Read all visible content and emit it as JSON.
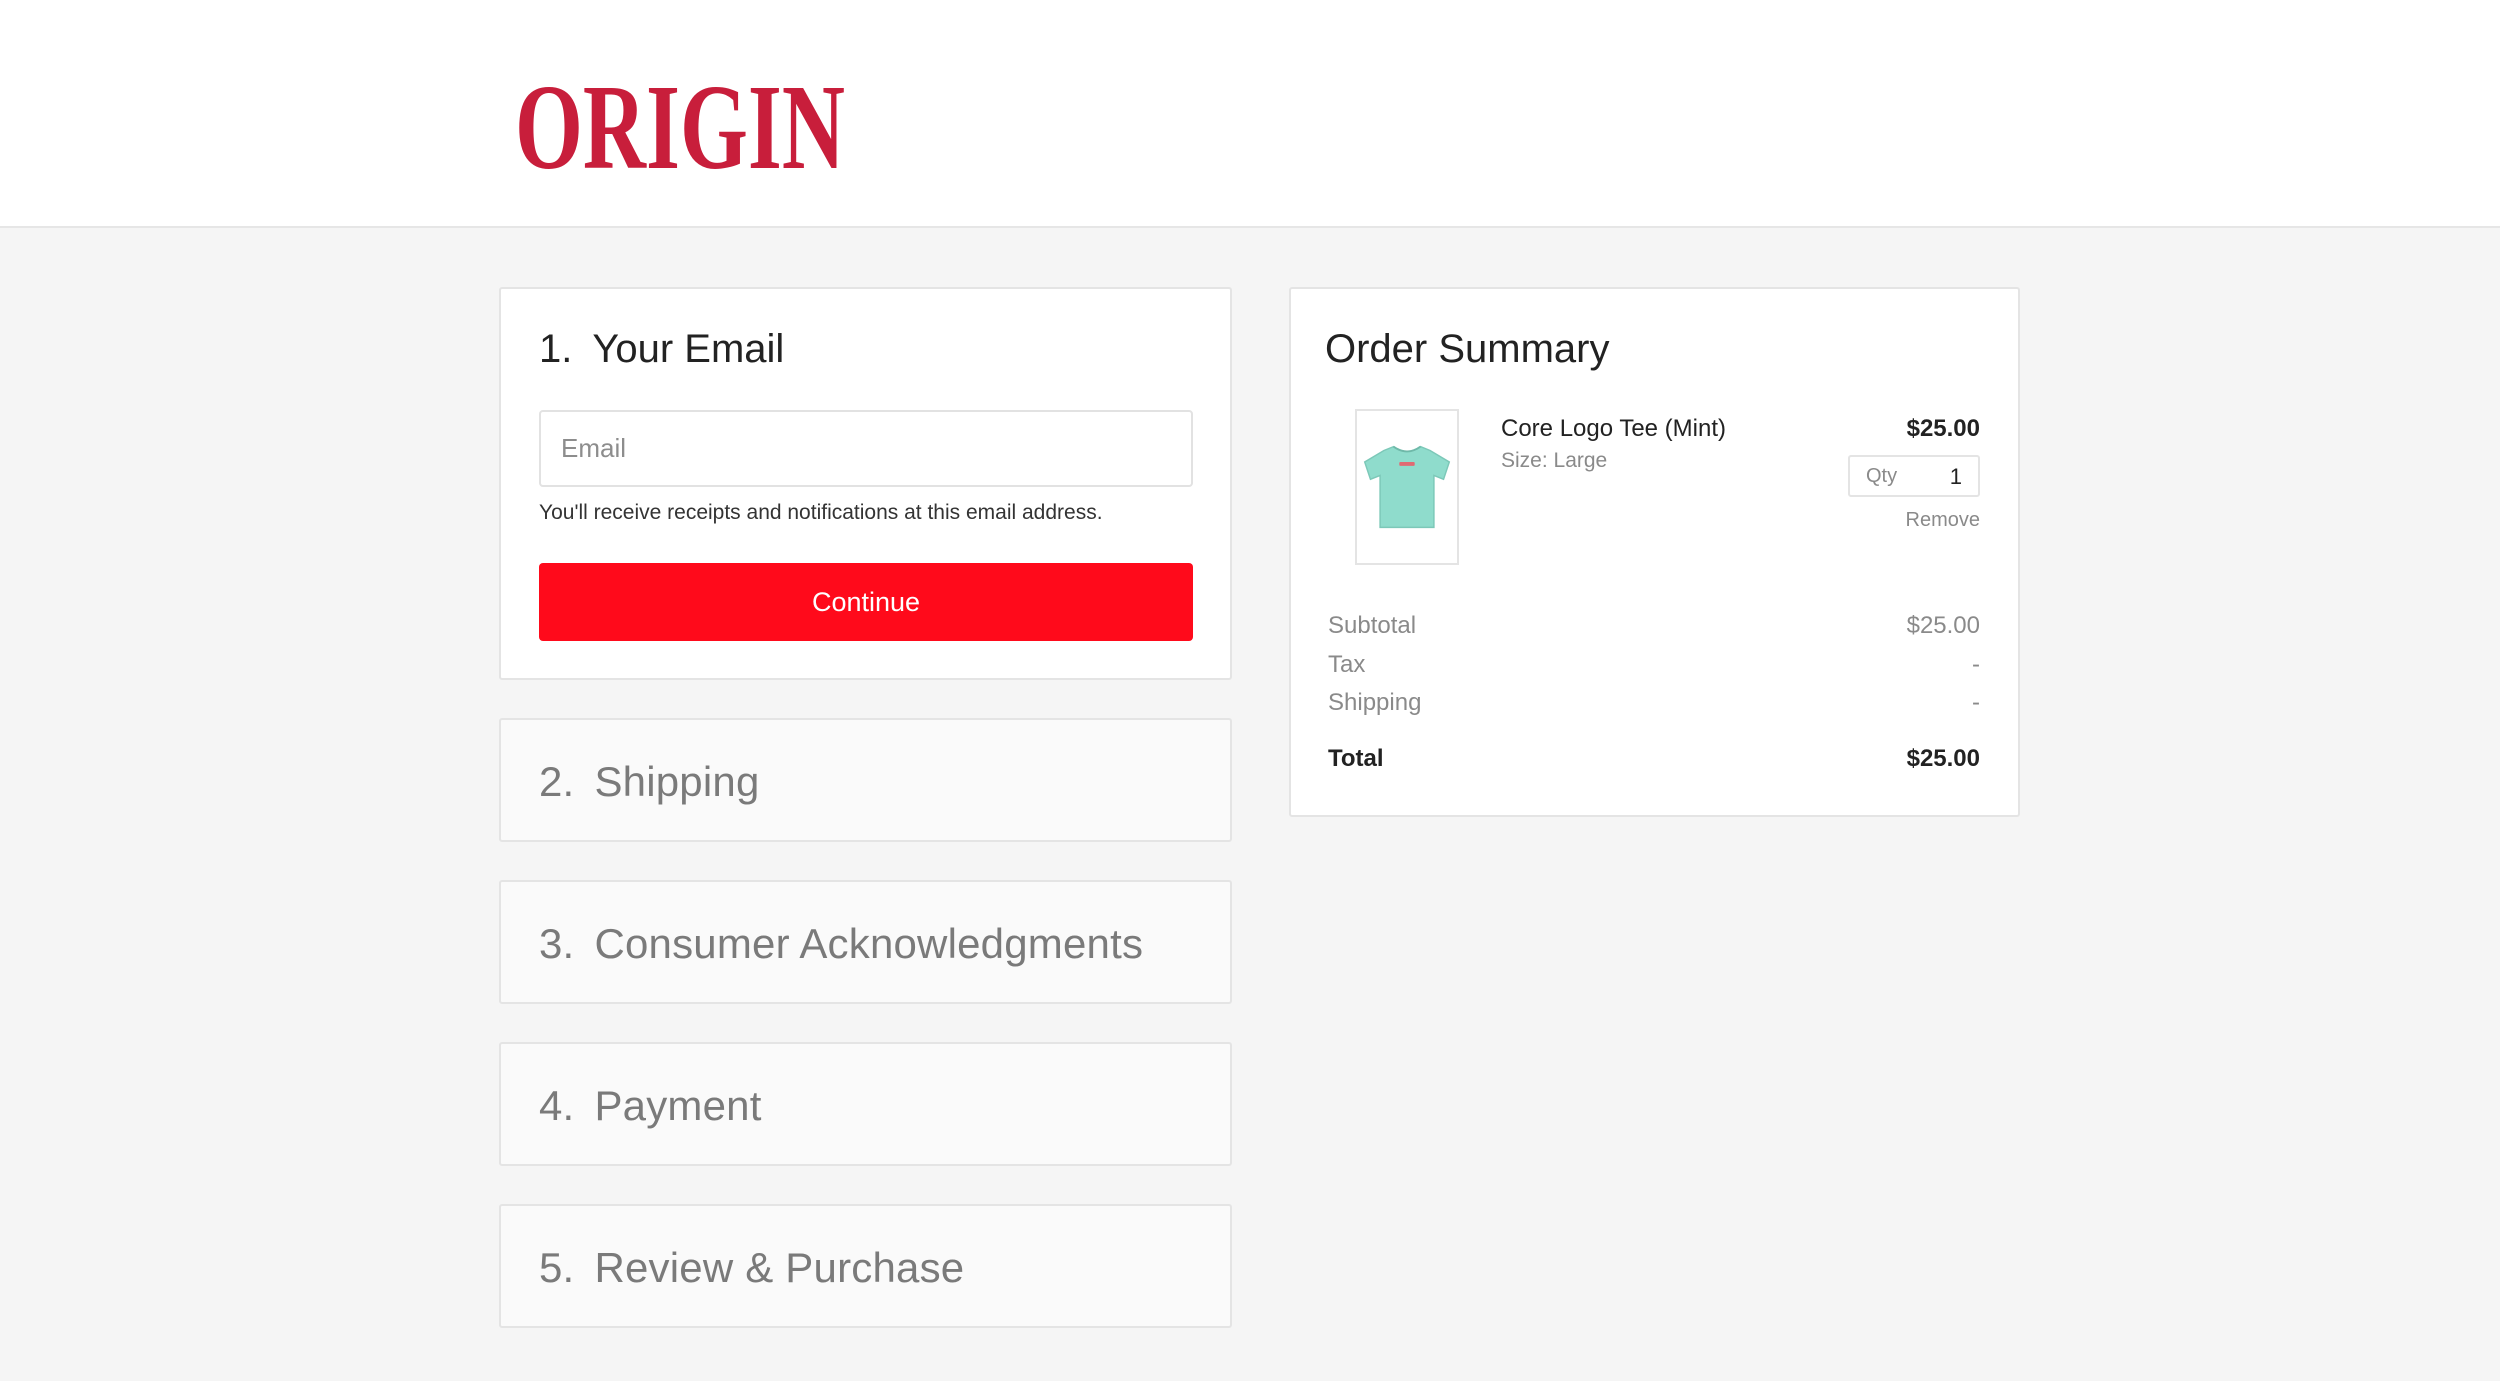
{
  "brand": {
    "logo_text": "ORIGIN",
    "logo_color": "#c81e3b"
  },
  "colors": {
    "accent": "#ff0a1b",
    "page_bg": "#f5f5f5",
    "card_bg": "#ffffff",
    "inactive_step_bg": "#fafafa",
    "shirt": "#8fdccc"
  },
  "checkout": {
    "email": {
      "number": "1.",
      "title": "Your Email",
      "placeholder": "Email",
      "value": "",
      "hint": "You'll receive receipts and notifications at this email address.",
      "continue_label": "Continue"
    },
    "steps": [
      {
        "number": "2.",
        "title": "Shipping"
      },
      {
        "number": "3.",
        "title": "Consumer Acknowledgments"
      },
      {
        "number": "4.",
        "title": "Payment"
      },
      {
        "number": "5.",
        "title": "Review & Purchase"
      }
    ]
  },
  "summary": {
    "title": "Order Summary",
    "item": {
      "name": "Core Logo Tee (Mint)",
      "size": "Size: Large",
      "price": "$25.00",
      "qty_label": "Qty",
      "qty": "1",
      "remove_label": "Remove",
      "thumb_icon": "t-shirt-icon"
    },
    "rows": [
      {
        "label": "Subtotal",
        "value": "$25.00"
      },
      {
        "label": "Tax",
        "value": "-"
      },
      {
        "label": "Shipping",
        "value": "-"
      }
    ],
    "total_label": "Total",
    "total_value": "$25.00"
  }
}
